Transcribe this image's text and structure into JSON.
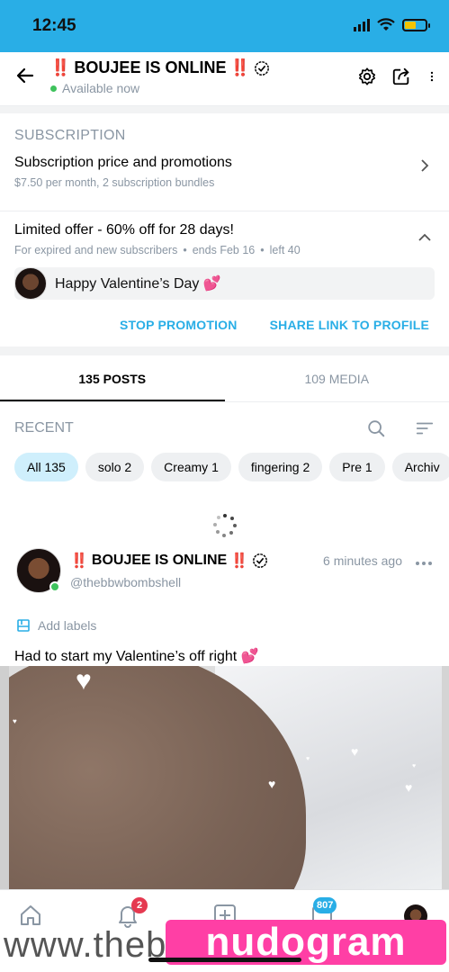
{
  "status_bar": {
    "time": "12:45",
    "battery_color": "#f4c400"
  },
  "header": {
    "title_prefix": "‼️",
    "title_name": "BOUJEE IS ONLINE",
    "title_suffix": "‼️",
    "status": "Available now",
    "icons": [
      "back-arrow-icon",
      "verified-icon",
      "settings-icon",
      "share-icon",
      "more-vertical-icon"
    ]
  },
  "subscription": {
    "section_label": "SUBSCRIPTION",
    "price_title": "Subscription price and promotions",
    "price_sub": "$7.50 per month, 2 subscription bundles"
  },
  "promotion": {
    "title": "Limited offer - 60% off for 28 days!",
    "meta": [
      "For expired and new subscribers",
      "ends Feb 16",
      "left 40"
    ],
    "message": "Happy Valentine’s Day",
    "message_emoji": "💕",
    "stop_label": "STOP PROMOTION",
    "share_label": "SHARE LINK TO PROFILE"
  },
  "tabs": [
    {
      "label": "135 POSTS",
      "active": true
    },
    {
      "label": "109 MEDIA",
      "active": false
    }
  ],
  "filter": {
    "label": "RECENT",
    "chips": [
      {
        "label": "All 135",
        "active": true
      },
      {
        "label": "solo 2",
        "active": false
      },
      {
        "label": "Creamy 1",
        "active": false
      },
      {
        "label": "fingering 2",
        "active": false
      },
      {
        "label": "Pre 1",
        "active": false
      },
      {
        "label": "Archiv",
        "active": false
      }
    ]
  },
  "post": {
    "name_prefix": "‼️",
    "name": "BOUJEE IS ONLINE",
    "name_suffix": "‼️",
    "handle": "@thebbwbombshell",
    "time": "6 minutes ago",
    "add_labels": "Add labels",
    "text": "Had to start my Valentine’s off right",
    "text_emoji": "💕"
  },
  "bottom_nav": {
    "icons": [
      "home-icon",
      "bell-icon",
      "add-post-icon",
      "messages-icon",
      "profile-avatar"
    ],
    "notifications_badge": "2",
    "messages_badge": "807"
  },
  "watermark": {
    "left": "www.theb",
    "right": "nudogram"
  },
  "colors": {
    "accent": "#29aee6",
    "muted": "#8a96a3",
    "online": "#3ec25c",
    "badge_red": "#e53950"
  }
}
